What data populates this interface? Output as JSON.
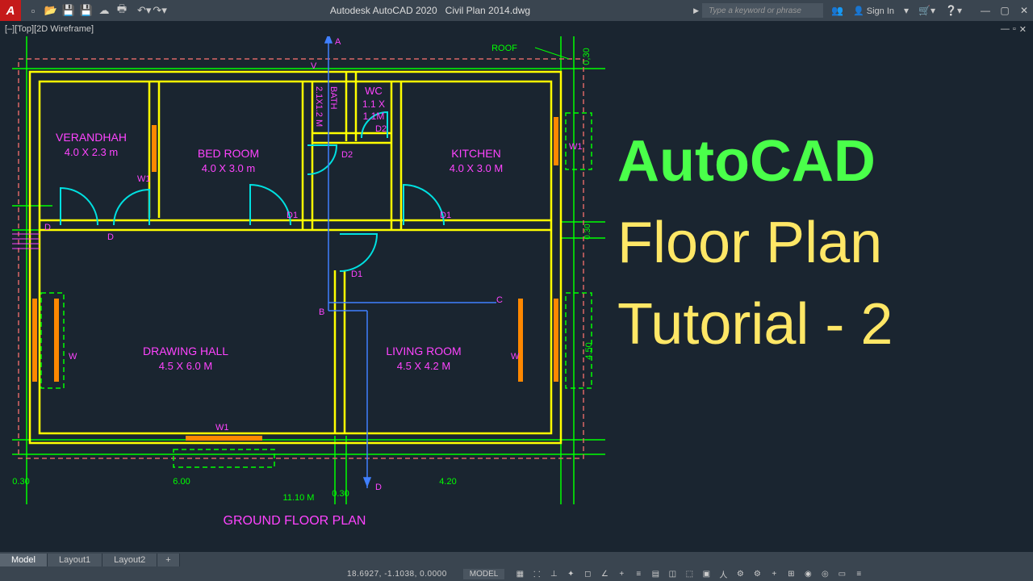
{
  "title": {
    "app": "Autodesk AutoCAD 2020",
    "file": "Civil Plan 2014.dwg"
  },
  "search": {
    "placeholder": "Type a keyword or phrase",
    "arrow": "▶"
  },
  "signin": "Sign In",
  "viewport": "[–][Top][2D Wireframe]",
  "tabs": {
    "model": "Model",
    "l1": "Layout1",
    "l2": "Layout2",
    "plus": "+"
  },
  "status": {
    "coords": "18.6927, -1.1038, 0.0000",
    "model": "MODEL"
  },
  "overlay": {
    "l1": "AutoCAD",
    "l2": "Floor Plan",
    "l3": "Tutorial - 2"
  },
  "plan": {
    "title": "GROUND FLOOR PLAN",
    "roof": "ROOF",
    "rooms": {
      "verandhah": {
        "name": "VERANDHAH",
        "dim": "4.0 X 2.3 m"
      },
      "bedroom": {
        "name": "BED ROOM",
        "dim": "4.0 X 3.0 m"
      },
      "bath": {
        "name": "BATH",
        "dim": "2.1X1.2 M"
      },
      "wc": {
        "name": "WC",
        "dim1": "1.1 X",
        "dim2": "1.1M"
      },
      "kitchen": {
        "name": "KITCHEN",
        "dim": "4.0 X 3.0 M"
      },
      "drawinghall": {
        "name": "DRAWING HALL",
        "dim": "4.5 X 6.0 M"
      },
      "livingroom": {
        "name": "LIVING ROOM",
        "dim": "4.5 X 4.2 M"
      }
    },
    "tags": {
      "A": "A",
      "B": "B",
      "C": "C",
      "D": "D",
      "V": "V",
      "W": "W",
      "W1": "W1",
      "D1": "D1",
      "D2": "D2"
    },
    "dims": {
      "d030": "0.30",
      "d600": "6.00",
      "d420": "4.20",
      "d1110": "11.10 M",
      "d450": "4.50",
      "d030v": "0,30"
    }
  }
}
